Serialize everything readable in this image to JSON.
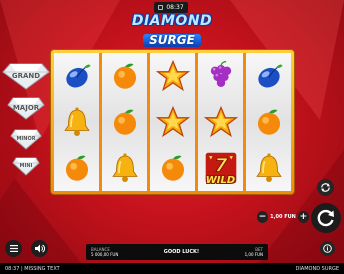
{
  "status": {
    "clock": "08:37"
  },
  "logo": {
    "line1": "DIAMOND",
    "line2": "SURGE"
  },
  "jackpots": [
    {
      "name": "jackpot-1",
      "label": "GRAND"
    },
    {
      "name": "jackpot-2",
      "label": "MAJOR"
    },
    {
      "name": "jackpot-3",
      "label": "MINOR"
    },
    {
      "name": "jackpot-4",
      "label": "MINI"
    }
  ],
  "reels": [
    [
      "plum",
      "bell",
      "orange"
    ],
    [
      "orange",
      "orange",
      "bell"
    ],
    [
      "star",
      "star",
      "orange"
    ],
    [
      "grapes",
      "star",
      "wild"
    ],
    [
      "plum",
      "orange",
      "bell"
    ]
  ],
  "wild_label": "WILD",
  "controls": {
    "bet_value": "1,00 FUN",
    "minus": "−",
    "plus": "+"
  },
  "info": {
    "balance_label": "BALANCE",
    "balance_value": "5 000,00 FUN",
    "message": "GOOD LUCK!",
    "bet_label": "BET",
    "bet_value": "1,00 FUN"
  },
  "footer": {
    "time": "08:37",
    "separator": "|",
    "status_text": "MISSING TEXT",
    "game_name": "DIAMOND SURGE"
  },
  "colors": {
    "background": "#c4121c",
    "frame": "#f5a01e",
    "panel": "#0c0c0c"
  }
}
